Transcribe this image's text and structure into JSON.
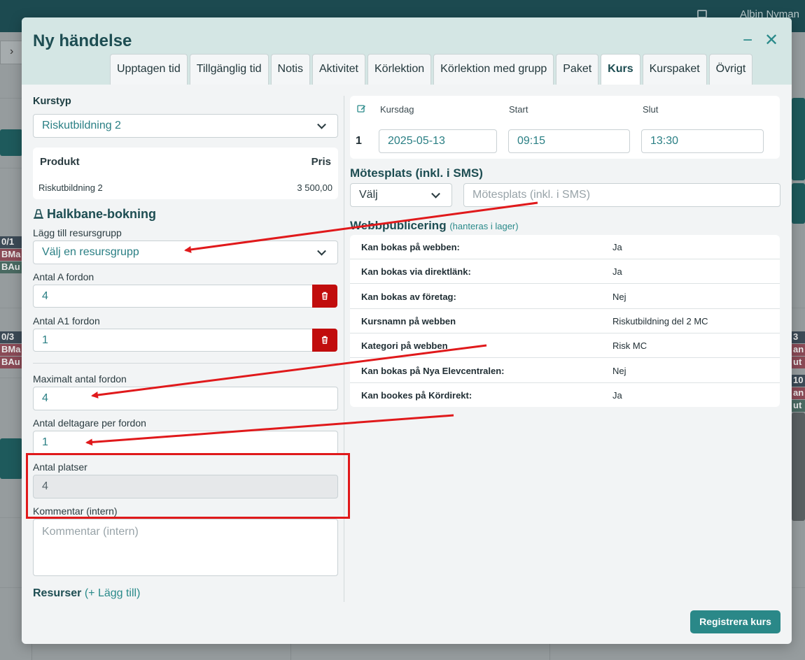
{
  "background": {
    "user_name": "Albin Nyman",
    "nav_arrow": "›",
    "left_chips": [
      {
        "label": "0/1",
        "color": "#3c4a56"
      },
      {
        "label": "BMa",
        "color": "#8a4a56"
      },
      {
        "label": "BAu",
        "color": "#4a6a62"
      },
      {
        "label": "0/3",
        "color": "#3c4a56"
      },
      {
        "label": "BMa",
        "color": "#8a4a56"
      },
      {
        "label": "BAu",
        "color": "#8a4a56"
      }
    ],
    "right_chips": [
      {
        "label": "3",
        "color": "#3c4a56"
      },
      {
        "label": "an",
        "color": "#8a4a56"
      },
      {
        "label": "ut",
        "color": "#8a4a56"
      },
      {
        "label": "10",
        "color": "#3c4a56"
      },
      {
        "label": "an",
        "color": "#8a4a56"
      },
      {
        "label": "ut",
        "color": "#4a6a62"
      }
    ]
  },
  "modal": {
    "title": "Ny händelse",
    "minimize_icon": "minimize-icon",
    "close_icon": "close-icon",
    "tabs": [
      {
        "label": "Upptagen tid",
        "active": false
      },
      {
        "label": "Tillgänglig tid",
        "active": false
      },
      {
        "label": "Notis",
        "active": false
      },
      {
        "label": "Aktivitet",
        "active": false
      },
      {
        "label": "Körlektion",
        "active": false
      },
      {
        "label": "Körlektion med grupp",
        "active": false
      },
      {
        "label": "Paket",
        "active": false
      },
      {
        "label": "Kurs",
        "active": true
      },
      {
        "label": "Kurspaket",
        "active": false
      },
      {
        "label": "Övrigt",
        "active": false
      }
    ]
  },
  "left": {
    "kurstyp_label": "Kurstyp",
    "kurstyp_value": "Riskutbildning 2",
    "product_header": "Produkt",
    "price_header": "Pris",
    "product_name": "Riskutbildning 2",
    "product_price": "3 500,00",
    "halkbane_title": "Halkbane-bokning",
    "resursgrupp_label": "Lägg till resursgrupp",
    "resursgrupp_value": "Välj en resursgrupp",
    "antal_a_label": "Antal A fordon",
    "antal_a_value": "4",
    "antal_a1_label": "Antal A1 fordon",
    "antal_a1_value": "1",
    "max_fordon_label": "Maximalt antal fordon",
    "max_fordon_value": "4",
    "deltagare_label": "Antal deltagare per fordon",
    "deltagare_value": "1",
    "platser_label": "Antal platser",
    "platser_value": "4",
    "kommentar_label": "Kommentar (intern)",
    "kommentar_placeholder": "Kommentar (intern)",
    "resurser_label": "Resurser",
    "resurser_add": "(+ Lägg till)"
  },
  "right": {
    "kursdag_header": "Kursdag",
    "start_header": "Start",
    "slut_header": "Slut",
    "day_number": "1",
    "kursdag_value": "2025-05-13",
    "start_value": "09:15",
    "slut_value": "13:30",
    "motesplats_title": "Mötesplats (inkl. i SMS)",
    "motesplats_select": "Välj",
    "motesplats_placeholder": "Mötesplats (inkl. i SMS)",
    "webb_title": "Webbpublicering",
    "webb_note": "(hanteras i lager)",
    "webb_rows": [
      {
        "key": "Kan bokas på webben:",
        "value": "Ja"
      },
      {
        "key": "Kan bokas via direktlänk:",
        "value": "Ja"
      },
      {
        "key": "Kan bokas av företag:",
        "value": "Nej"
      },
      {
        "key": "Kursnamn på webben",
        "value": "Riskutbildning del 2 MC"
      },
      {
        "key": "Kategori på webben",
        "value": "Risk MC"
      },
      {
        "key": "Kan bokas på Nya Elevcentralen:",
        "value": "Nej"
      },
      {
        "key": "Kan bookes på Kördirekt:",
        "value": "Ja"
      }
    ]
  },
  "footer": {
    "submit_label": "Registrera kurs"
  },
  "colors": {
    "accent": "#2a8888",
    "danger": "#c10d0d",
    "annotation": "#e0191b"
  }
}
